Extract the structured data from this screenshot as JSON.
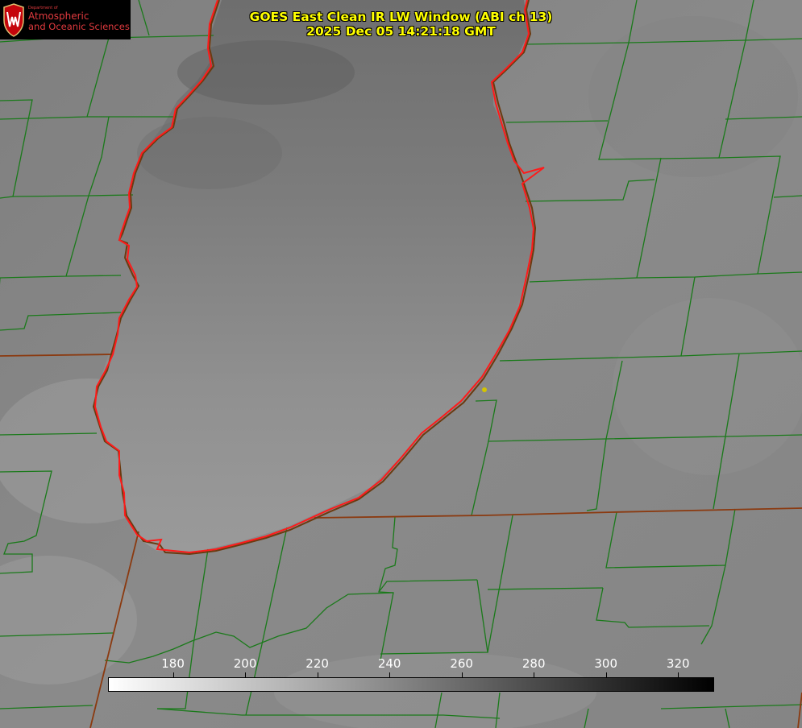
{
  "logo": {
    "department": "Department of",
    "line1": "Atmospheric",
    "line2": "and Oceanic Sciences",
    "color": "#e03a3e"
  },
  "title": {
    "line1": "GOES East Clean IR LW Window (ABI ch 13)",
    "line2": "2025 Dec 05 14:21:18 GMT",
    "color": "#ffff00"
  },
  "colorbar": {
    "ticks": [
      "180",
      "200",
      "220",
      "240",
      "260",
      "280",
      "300",
      "320"
    ],
    "range": [
      162,
      330
    ],
    "low_color": "#ffffff",
    "high_color": "#000000"
  },
  "map": {
    "county_line_color": "#1a7a1a",
    "state_line_color": "#8b3a10",
    "lake_outline_color": "#ff0000",
    "marker_color": "#d4c400"
  }
}
